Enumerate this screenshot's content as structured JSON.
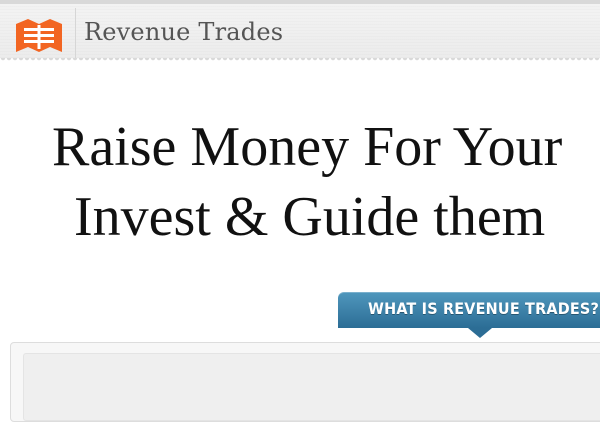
{
  "header": {
    "brand_name": "Revenue Trades",
    "logo_icon": "revenue-trades-logo-icon",
    "logo_color": "#f26522"
  },
  "hero": {
    "line1": "Raise Money For Your",
    "line2": "Invest & Guide them"
  },
  "tab": {
    "label": "WHAT IS REVENUE TRADES?",
    "color": "#2f76a0"
  }
}
